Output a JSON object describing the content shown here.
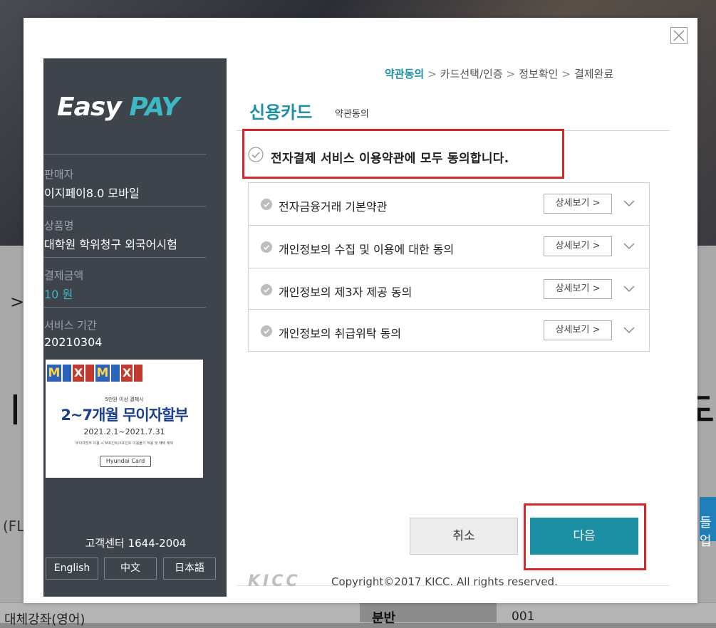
{
  "background": {
    "chevron": ">",
    "fragment_left": "(FL",
    "fragment_right": "들업",
    "table_row": {
      "col1": "대체강좌(영어)",
      "col2": "분반",
      "col3": "001"
    }
  },
  "modal": {
    "close_icon": "close-icon",
    "left_panel": {
      "logo_easy": "Easy",
      "logo_pay": "PAY",
      "seller_label": "판매자",
      "seller_value": "이지페이8.0 모바일",
      "product_label": "상품명",
      "product_value": "대학원 학위청구 외국어시험",
      "amount_label": "결제금액",
      "amount_value": "10 원",
      "period_label": "서비스 기간",
      "period_value": "20210304",
      "banner": {
        "small_text": "5만원 이상 결제시",
        "headline": "2~7개월 무이자할부",
        "date_range": "2021.2.1~2021.7.31",
        "fine_print": "무이자할부 이용 시 M포인트/X포인트 이용불가 적용 및 혜택 제외",
        "brand": "Hyundai Card"
      },
      "customer_center": "고객센터 1644-2004",
      "languages": [
        "English",
        "中文",
        "日本語"
      ]
    },
    "steps": {
      "step1": "약관동의",
      "step2": "카드선택/인증",
      "step3": "정보확인",
      "step4": "결제완료",
      "separator": ">"
    },
    "title": "신용카드",
    "subtitle": "약관동의",
    "agree_all": "전자결제 서비스 이용약관에 모두 동의합니다.",
    "terms": [
      {
        "label": "전자금융거래 기본약관",
        "detail": "상세보기 >"
      },
      {
        "label": "개인정보의 수집 및 이용에 대한 동의",
        "detail": "상세보기 >"
      },
      {
        "label": "개인정보의 제3자 제공 동의",
        "detail": "상세보기 >"
      },
      {
        "label": "개인정보의 취급위탁 동의",
        "detail": "상세보기 >"
      }
    ],
    "buttons": {
      "cancel": "취소",
      "next": "다음"
    },
    "footer": {
      "kicc": "KICC",
      "copyright": "Copyright©2017 KICC. All rights reserved."
    },
    "colors": {
      "accent": "#1b8fa3",
      "highlight": "#d9252c",
      "panel": "#3e444c"
    }
  }
}
